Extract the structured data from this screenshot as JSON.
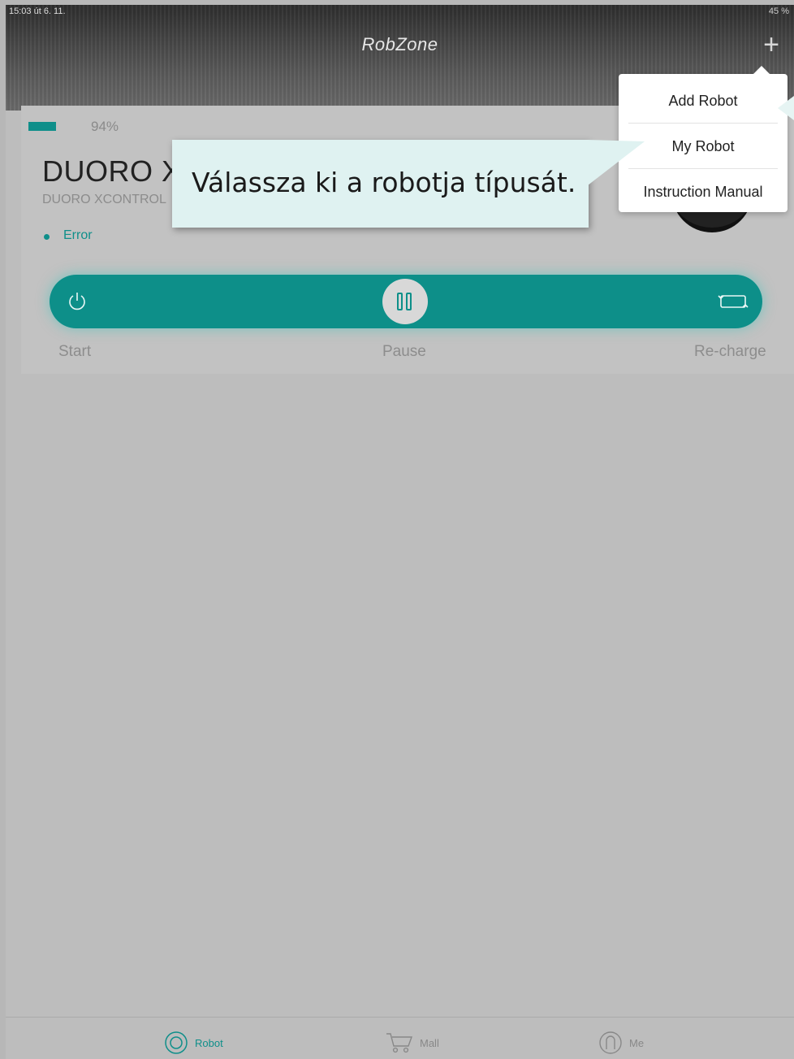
{
  "status_bar": {
    "time": "15:03  út 6. 11.",
    "battery": "45 %"
  },
  "header": {
    "title": "RobZone",
    "add_icon": "plus-icon"
  },
  "robot": {
    "battery_level": 0.94,
    "battery_text": "94%",
    "name": "DUORO XC",
    "model": "DUORO XCONTROL",
    "status": "Error"
  },
  "controls": {
    "start_label": "Start",
    "pause_label": "Pause",
    "recharge_label": "Re-charge"
  },
  "menu": {
    "items": [
      {
        "label": "Add Robot"
      },
      {
        "label": "My Robot"
      },
      {
        "label": "Instruction Manual"
      }
    ]
  },
  "callout": {
    "text": "Válassza ki a robotja típusát."
  },
  "tabbar": {
    "tabs": [
      {
        "label": "Robot",
        "icon": "robot-icon",
        "active": true
      },
      {
        "label": "Mall",
        "icon": "cart-icon",
        "active": false
      },
      {
        "label": "Me",
        "icon": "user-icon",
        "active": false
      }
    ]
  },
  "colors": {
    "accent": "#0f8f8a",
    "callout_bg": "#dff2f1"
  }
}
